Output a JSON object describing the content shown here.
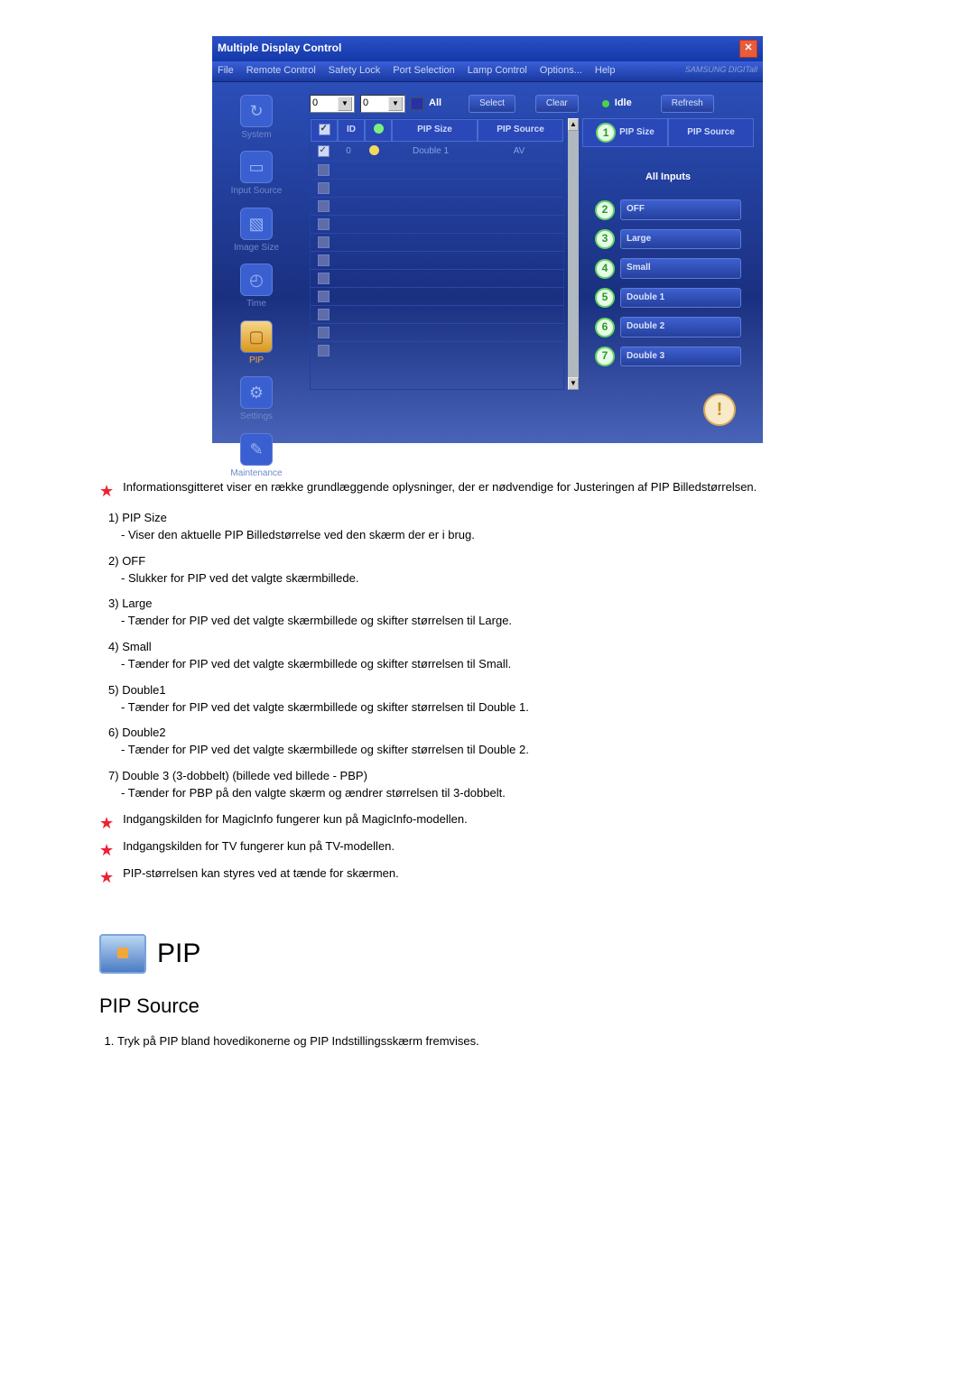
{
  "window": {
    "title": "Multiple Display Control",
    "menu": [
      "File",
      "Remote Control",
      "Safety Lock",
      "Port Selection",
      "Lamp Control",
      "Options...",
      "Help"
    ],
    "brand": "SAMSUNG DIGITall"
  },
  "sidebar": [
    {
      "label": "System",
      "icon": "↻"
    },
    {
      "label": "Input Source",
      "icon": "▭"
    },
    {
      "label": "Image Size",
      "icon": "▧"
    },
    {
      "label": "Time",
      "icon": "◴"
    },
    {
      "label": "PIP",
      "icon": "▢"
    },
    {
      "label": "Settings",
      "icon": "⚙"
    },
    {
      "label": "Maintenance",
      "icon": "✎"
    }
  ],
  "toolbar": {
    "sel1": "0",
    "sel2": "0",
    "all": "All",
    "select": "Select",
    "clear": "Clear",
    "idle": "Idle",
    "refresh": "Refresh"
  },
  "grid": {
    "headers": [
      "",
      "ID",
      "",
      "PIP Size",
      "PIP Source"
    ],
    "row": {
      "id": "0",
      "pipsize": "Double 1",
      "pipsource": "AV"
    }
  },
  "right": {
    "head": [
      "PIP Size",
      "PIP Source"
    ],
    "callout1": "1",
    "allinputs": "All Inputs",
    "buttons": [
      {
        "n": "2",
        "label": "OFF"
      },
      {
        "n": "3",
        "label": "Large"
      },
      {
        "n": "4",
        "label": "Small"
      },
      {
        "n": "5",
        "label": "Double 1"
      },
      {
        "n": "6",
        "label": "Double 2"
      },
      {
        "n": "7",
        "label": "Double 3"
      }
    ]
  },
  "notes": {
    "intro": "Informationsgitteret viser en række grundlæggende oplysninger, der er nødvendige for Justeringen af PIP Billedstørrelsen.",
    "list": [
      {
        "n": "1)",
        "t": "PIP Size",
        "d": "- Viser den aktuelle PIP Billedstørrelse ved den skærm der er i brug."
      },
      {
        "n": "2)",
        "t": "OFF",
        "d": "- Slukker for PIP ved det valgte skærmbillede."
      },
      {
        "n": "3)",
        "t": "Large",
        "d": "- Tænder for PIP ved det valgte skærmbillede og skifter størrelsen til Large."
      },
      {
        "n": "4)",
        "t": "Small",
        "d": "- Tænder for PIP ved det valgte skærmbillede og skifter størrelsen til Small."
      },
      {
        "n": "5)",
        "t": "Double1",
        "d": "- Tænder for PIP ved det valgte skærmbillede og skifter størrelsen til Double 1."
      },
      {
        "n": "6)",
        "t": "Double2",
        "d": "- Tænder for PIP ved det valgte skærmbillede og skifter størrelsen til Double 2."
      },
      {
        "n": "7)",
        "t": "Double 3 (3-dobbelt) (billede ved billede - PBP)",
        "d": "- Tænder for PBP på den valgte skærm og ændrer størrelsen til 3-dobbelt."
      }
    ],
    "stars": [
      "Indgangskilden for MagicInfo fungerer kun på MagicInfo-modellen.",
      "Indgangskilden for TV fungerer kun på TV-modellen.",
      "PIP-størrelsen kan styres ved at tænde for skærmen."
    ]
  },
  "section": {
    "pip": "PIP",
    "sub": "PIP Source",
    "step1": "Tryk på PIP bland hovedikonerne og PIP Indstillingsskærm fremvises."
  }
}
